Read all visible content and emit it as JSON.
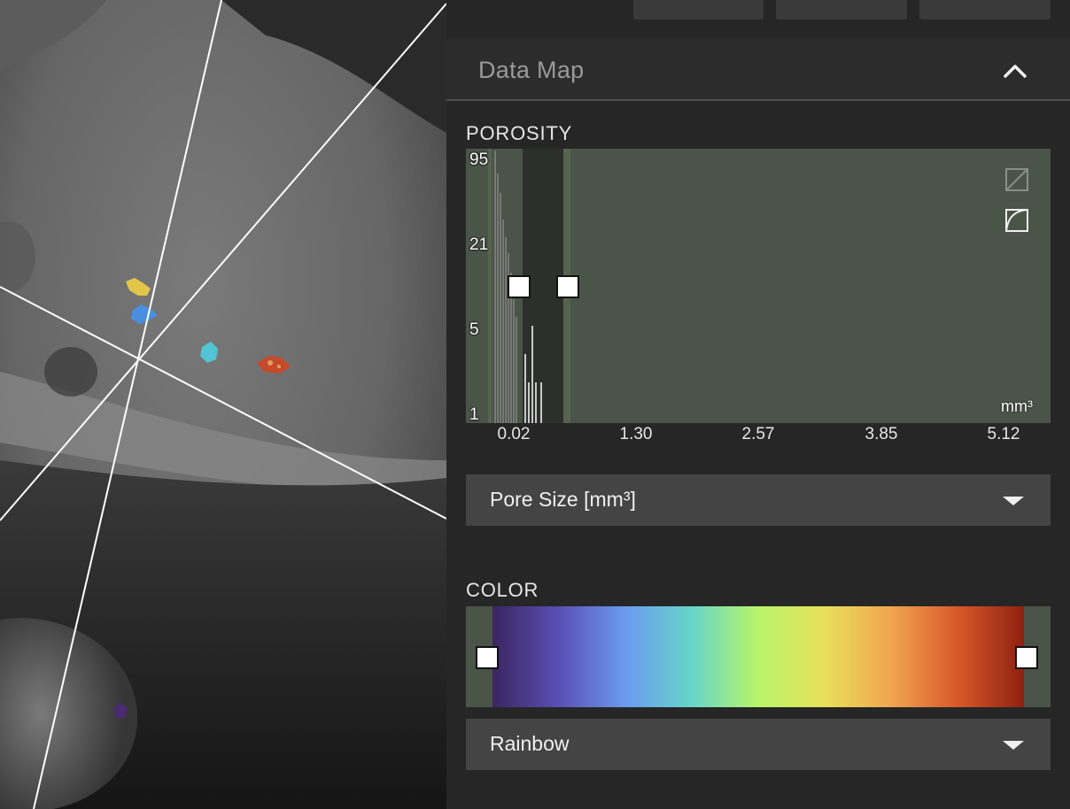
{
  "panel": {
    "section_title": "Data Map",
    "porosity_label": "POROSITY",
    "color_label": "COLOR"
  },
  "histogram": {
    "y_ticks": [
      "95",
      "21",
      "5",
      "1"
    ],
    "x_ticks": [
      "0.02",
      "1.30",
      "2.57",
      "3.85",
      "5.12"
    ],
    "unit": "mm³",
    "scale_linear_icon": "linear-scale-icon",
    "scale_log_icon": "log-scale-icon"
  },
  "size_dropdown": {
    "value": "Pore Size [mm³]"
  },
  "colormap_dropdown": {
    "value": "Rainbow"
  },
  "colors": {
    "accent_range": "#4a5448",
    "gradient_stops": [
      "#3b2560",
      "#5a4fb5",
      "#6a9af0",
      "#66d6c8",
      "#b8f46a",
      "#e8e05a",
      "#f0a550",
      "#d8582a",
      "#8e2010"
    ]
  }
}
